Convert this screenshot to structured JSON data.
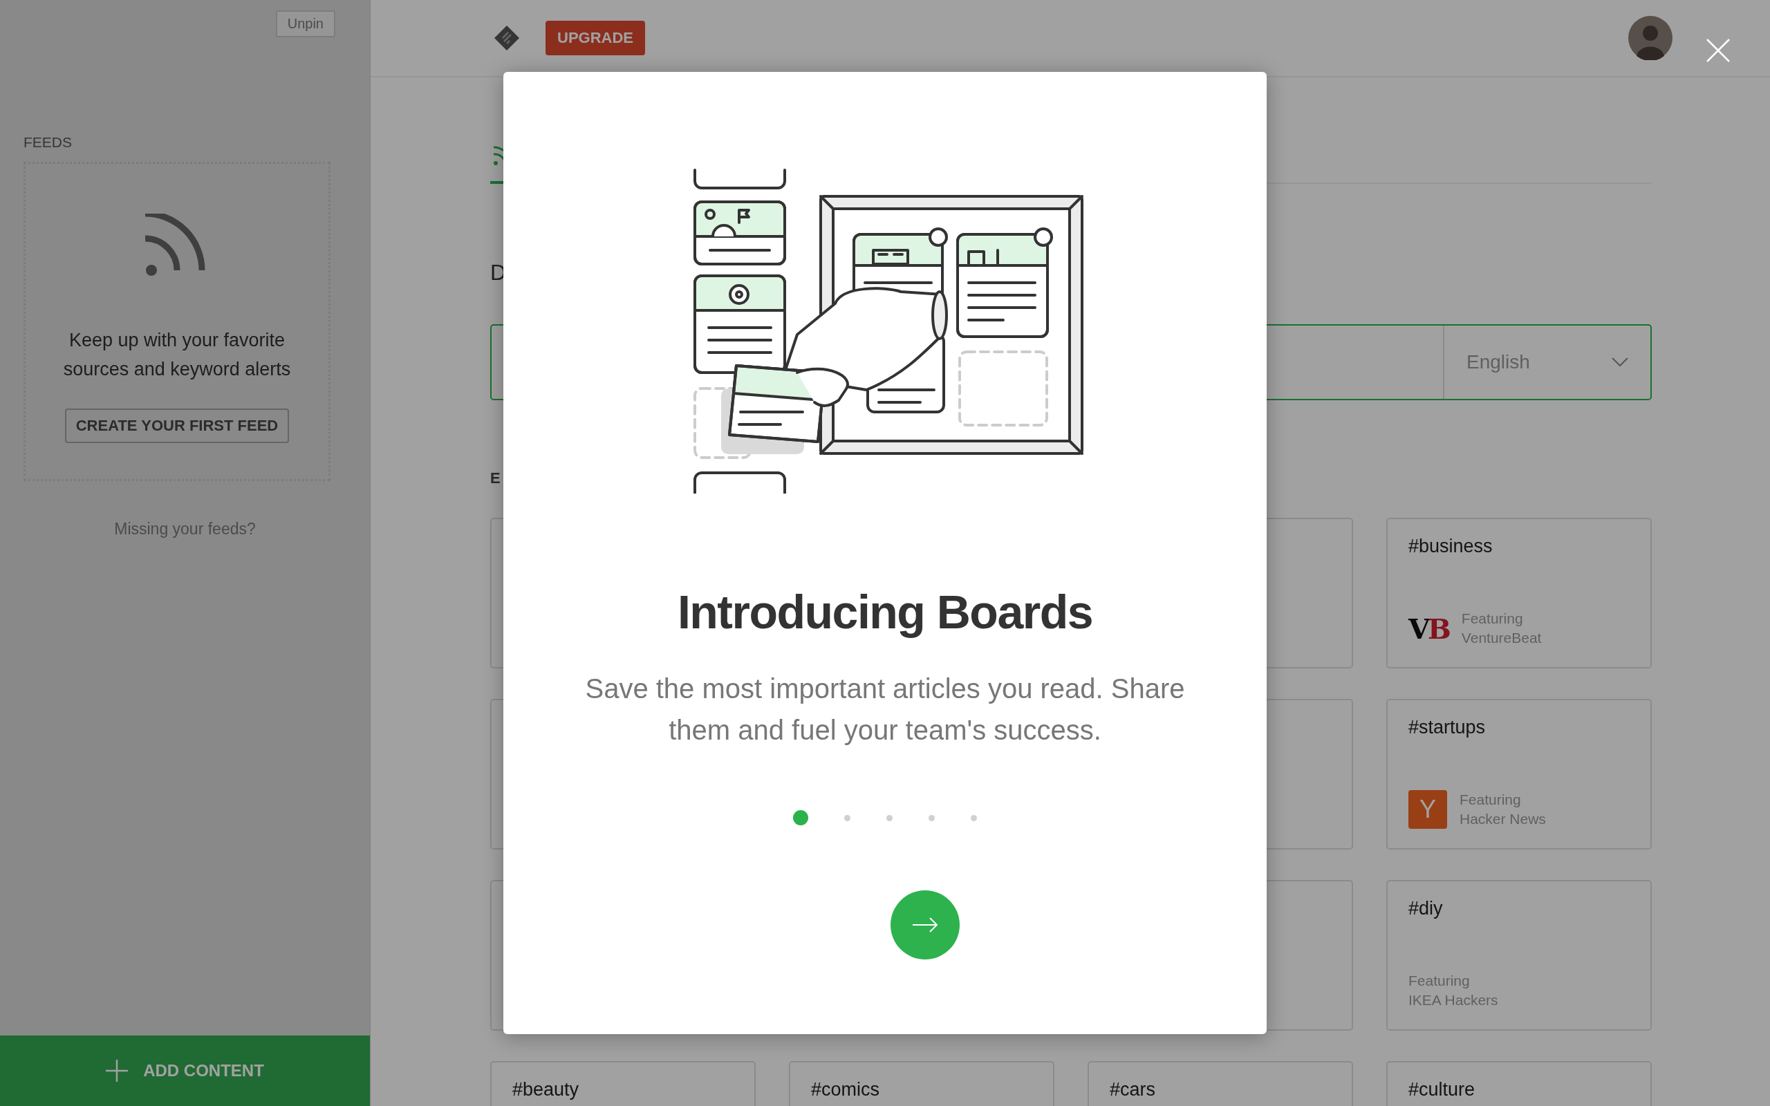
{
  "sidebar": {
    "unpin_button": "Unpin",
    "section_title": "FEEDS",
    "empty_state": {
      "message": "Keep up with your favorite sources and keyword alerts",
      "button": "CREATE YOUR FIRST FEED"
    },
    "missing_link": "Missing your feeds?",
    "add_content_button": "ADD CONTENT"
  },
  "header": {
    "upgrade_button": "UPGRADE"
  },
  "main": {
    "heading": "D",
    "language_select": {
      "value": "English"
    },
    "section_label": "E",
    "featured_topics": [
      {
        "title": "#business",
        "featuring_label": "Featuring",
        "source": "VentureBeat",
        "logo": {
          "kind": "vb",
          "letters": [
            "V",
            "B"
          ]
        }
      },
      {
        "title": "#startups",
        "featuring_label": "Featuring",
        "source": "Hacker News",
        "logo": {
          "kind": "y",
          "letters": [
            "Y"
          ]
        }
      },
      {
        "title": "#diy",
        "featuring_label": "Featuring",
        "source": "IKEA Hackers"
      }
    ],
    "more_topics": [
      {
        "title": "#beauty"
      },
      {
        "title": "#comics"
      },
      {
        "title": "#cars"
      },
      {
        "title": "#culture"
      }
    ]
  },
  "modal": {
    "title": "Introducing Boards",
    "body": "Save the most important articles you read. Share them and fuel your team's success.",
    "pages": [
      {
        "selected": true
      },
      {
        "selected": false
      },
      {
        "selected": false
      },
      {
        "selected": false
      },
      {
        "selected": false
      }
    ]
  }
}
